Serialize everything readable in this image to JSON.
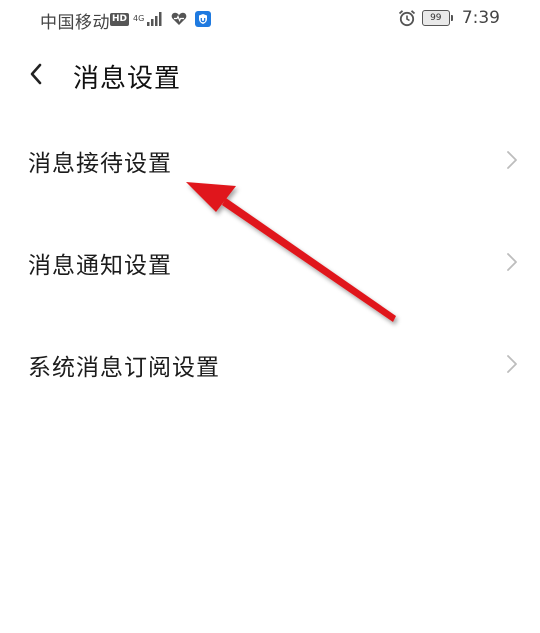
{
  "status_bar": {
    "carrier": "中国移动",
    "hd_label": "HD",
    "network_type": "4G",
    "battery_level": "99",
    "time": "7:39",
    "icons": [
      "hd-icon",
      "signal-icon",
      "heart-icon",
      "shield-app-icon",
      "alarm-icon",
      "battery-icon"
    ]
  },
  "header": {
    "back_icon": "chevron-left-icon",
    "title": "消息设置"
  },
  "settings": {
    "items": [
      {
        "label": "消息接待设置"
      },
      {
        "label": "消息通知设置"
      },
      {
        "label": "系统消息订阅设置"
      }
    ],
    "chevron_icon": "chevron-right-icon"
  },
  "colors": {
    "annotation_arrow": "#e0191b",
    "chevron": "#bdbdbd",
    "shield_icon": "#1f7ae0"
  }
}
